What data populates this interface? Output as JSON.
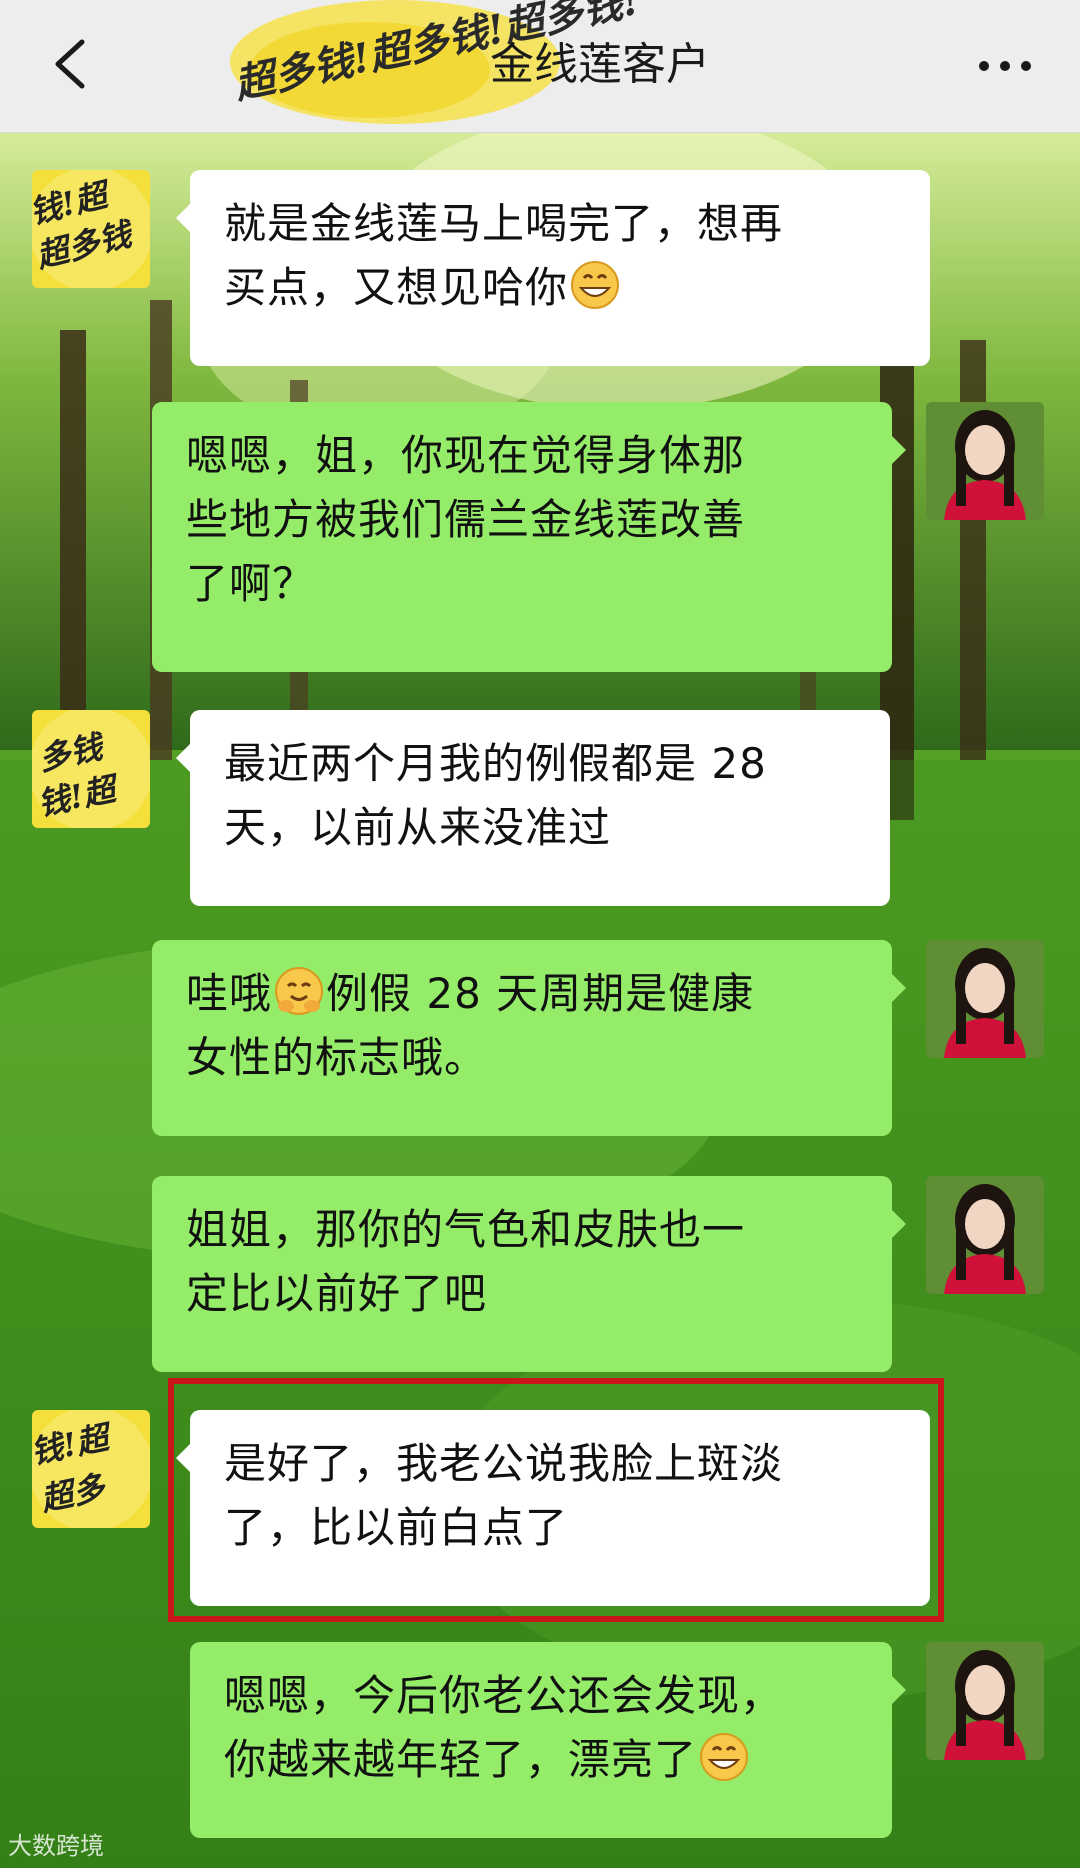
{
  "header": {
    "title": "金线莲客户",
    "sticker_text": "超多钱!超多钱!超多钱!"
  },
  "messages": [
    {
      "side": "in",
      "text_lines": [
        "就是金线莲马上喝完了，想再",
        "买点，又想见哈你"
      ],
      "emoji": "grinning-face"
    },
    {
      "side": "out",
      "text_lines": [
        "嗯嗯，姐，你现在觉得身体那",
        "些地方被我们儒兰金线莲改善",
        "了啊？"
      ]
    },
    {
      "side": "in",
      "text_lines": [
        "最近两个月我的例假都是 28",
        "天，以前从来没准过"
      ]
    },
    {
      "side": "out",
      "text_lines_pre": "哇哦",
      "text_lines_post": "例假 28 天周期是健康",
      "text_line2": "女性的标志哦。",
      "emoji": "hugging-face"
    },
    {
      "side": "out",
      "text_lines": [
        "姐姐，那你的气色和皮肤也一",
        "定比以前好了吧"
      ]
    },
    {
      "side": "in",
      "text_lines": [
        "是好了，我老公说我脸上斑淡",
        "了，比以前白点了"
      ],
      "highlighted": true
    },
    {
      "side": "out",
      "text_lines": [
        "嗯嗯，今后你老公还会发现，",
        "你越来越年轻了，漂亮了"
      ],
      "emoji": "grinning-face"
    }
  ],
  "watermark": "大数跨境",
  "colors": {
    "incoming_bubble": "#ffffff",
    "outgoing_bubble": "#95ec69",
    "highlight": "#c8171a",
    "header_bg": "#ededed"
  }
}
